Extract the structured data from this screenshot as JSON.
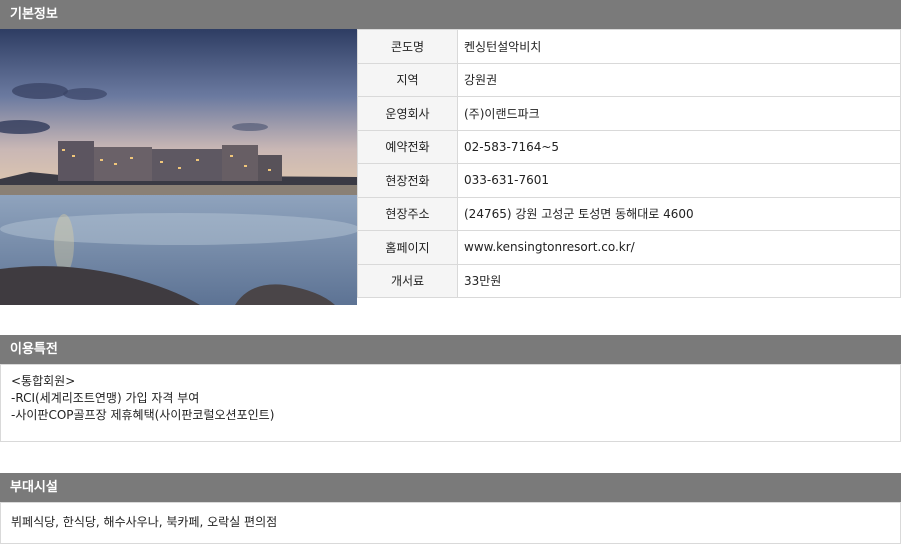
{
  "basic_info": {
    "title": "기본정보",
    "rows": [
      {
        "label": "콘도명",
        "value": "켄싱턴설악비치"
      },
      {
        "label": "지역",
        "value": "강원권"
      },
      {
        "label": "운영회사",
        "value": "(주)이랜드파크"
      },
      {
        "label": "예약전화",
        "value": "02-583-7164~5"
      },
      {
        "label": "현장전화",
        "value": "033-631-7601"
      },
      {
        "label": "현장주소",
        "value": "(24765) 강원 고성군 토성면 동해대로 4600"
      },
      {
        "label": "홈페이지",
        "value": "www.kensingtonresort.co.kr/"
      },
      {
        "label": "개서료",
        "value": "33만원"
      }
    ]
  },
  "benefits": {
    "title": "이용특전",
    "lines": [
      "<통합회원>",
      "-RCI(세계리조트연맹) 가입 자격 부여",
      "-사이판COP골프장 제휴혜택(사이판코럴오션포인트)"
    ]
  },
  "facilities": {
    "title": "부대시설",
    "text": "뷔페식당, 한식당, 해수사우나, 북카페, 오락실 편의점"
  }
}
